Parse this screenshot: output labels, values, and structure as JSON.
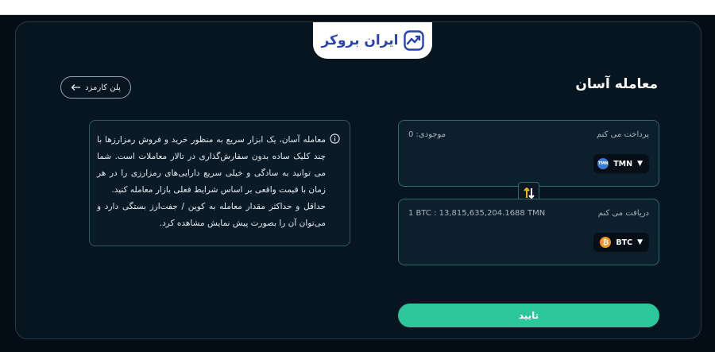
{
  "brand": {
    "name": "ایران بروکر",
    "color": "#2743b4",
    "icon": "trend-chart-logo-icon"
  },
  "header": {
    "title": "معامله آسان",
    "fee_button_label": "پلن کارمزد"
  },
  "info": {
    "icon": "info-icon",
    "paragraph1": "معامله آسان، یک ابزار سریع به منظور خرید و فروش رمزارزها با چند کلیک ساده بدون سفارش‌گذاری در تالار معاملات است. شما می توانید به سادگی و خیلی سریع دارایی‌های رمزارزی را در هر زمان با قیمت واقعی بر اساس شرایط فعلی بازار معامله کنید.",
    "paragraph2": "حداقل و حداکثر مقدار معامله به کوین / جفت‌ارز بستگی دارد و می‌توان آن را بصورت پیش نمایش مشاهده کرد."
  },
  "pay": {
    "label": "پرداخت می کنم",
    "balance": "موجودی: 0",
    "asset_code": "TMN",
    "asset_icon_text": "TMN"
  },
  "receive": {
    "label": "دریافت می کنم",
    "rate": "1 BTC : 13,815,635,204.1688 TMN",
    "asset_code": "BTC",
    "asset_icon_text": "₿"
  },
  "swap": {
    "icon": "swap-arrows-icon"
  },
  "confirm": {
    "label": "تایید",
    "color": "#2bc69a"
  },
  "colors": {
    "background": "#040c16",
    "card": "#071521",
    "accent": "#2bc69a",
    "swap_accent": "#f0b90b"
  }
}
